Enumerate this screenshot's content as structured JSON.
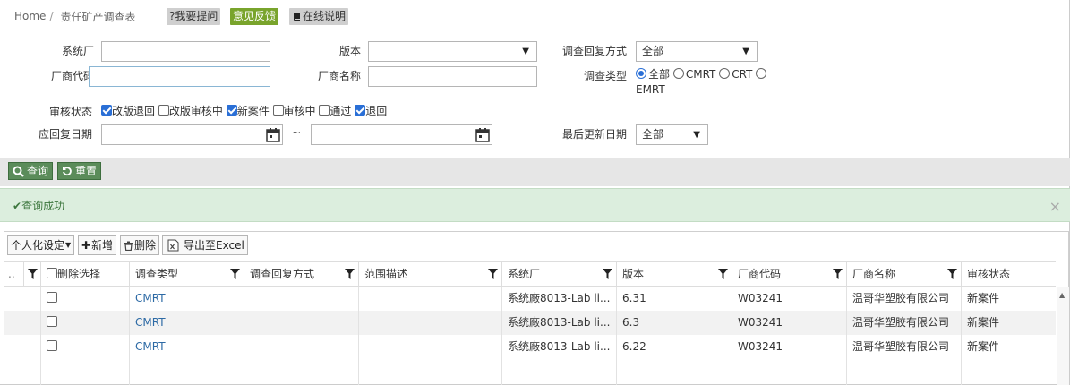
{
  "breadcrumb": {
    "home": "Home",
    "separator": "/",
    "current": "责任矿产调查表"
  },
  "header_buttons": {
    "ask": "?我要提问",
    "feedback": "意见反馈",
    "manual": "在线说明"
  },
  "form": {
    "system_factory": {
      "label": "系统厂",
      "value": ""
    },
    "version": {
      "label": "版本",
      "value": ""
    },
    "reply_method": {
      "label": "调查回复方式",
      "value": "全部"
    },
    "vendor_code": {
      "label": "厂商代码",
      "value": ""
    },
    "vendor_name": {
      "label": "厂商名称",
      "value": ""
    },
    "survey_type": {
      "label": "调查类型",
      "options": [
        {
          "label": "全部",
          "selected": true
        },
        {
          "label": "CMRT",
          "selected": false
        },
        {
          "label": "CRT",
          "selected": false
        },
        {
          "label": "EMRT",
          "selected": false
        }
      ]
    },
    "review_status": {
      "label": "审核状态",
      "options": [
        {
          "label": "改版退回",
          "checked": true
        },
        {
          "label": "改版审核中",
          "checked": false
        },
        {
          "label": "新案件",
          "checked": true
        },
        {
          "label": "审核中",
          "checked": false
        },
        {
          "label": "通过",
          "checked": false
        },
        {
          "label": "退回",
          "checked": true
        }
      ]
    },
    "reply_date": {
      "label": "应回复日期",
      "from": "",
      "range_sep": "~",
      "to": ""
    },
    "last_update": {
      "label": "最后更新日期",
      "value": "全部"
    }
  },
  "actions": {
    "query": "查询",
    "reset": "重置"
  },
  "alert": {
    "message": "查询成功",
    "close": "×"
  },
  "grid_toolbar": {
    "personalize": "个人化设定",
    "add": "新增",
    "delete": "删除",
    "export": "导出至Excel"
  },
  "table": {
    "columns": [
      "..",
      "删除选择",
      "调查类型",
      "调查回复方式",
      "范围描述",
      "系统厂",
      "版本",
      "厂商代码",
      "厂商名称",
      "审核状态"
    ],
    "rows": [
      {
        "type": "CMRT",
        "reply": "",
        "scope": "",
        "factory": "系统廠8013-Lab li...",
        "version": "6.31",
        "code": "W03241",
        "name": "温哥华塑胶有限公司",
        "status": "新案件"
      },
      {
        "type": "CMRT",
        "reply": "",
        "scope": "",
        "factory": "系统廠8013-Lab li...",
        "version": "6.3",
        "code": "W03241",
        "name": "温哥华塑胶有限公司",
        "status": "新案件"
      },
      {
        "type": "CMRT",
        "reply": "",
        "scope": "",
        "factory": "系统廠8013-Lab li...",
        "version": "6.22",
        "code": "W03241",
        "name": "温哥华塑胶有限公司",
        "status": "新案件"
      }
    ]
  },
  "colors": {
    "feedback_green": "#79a42c",
    "button_green": "#5b8c5a",
    "alert_bg": "#dceede",
    "link_blue": "#2d6aa5"
  }
}
